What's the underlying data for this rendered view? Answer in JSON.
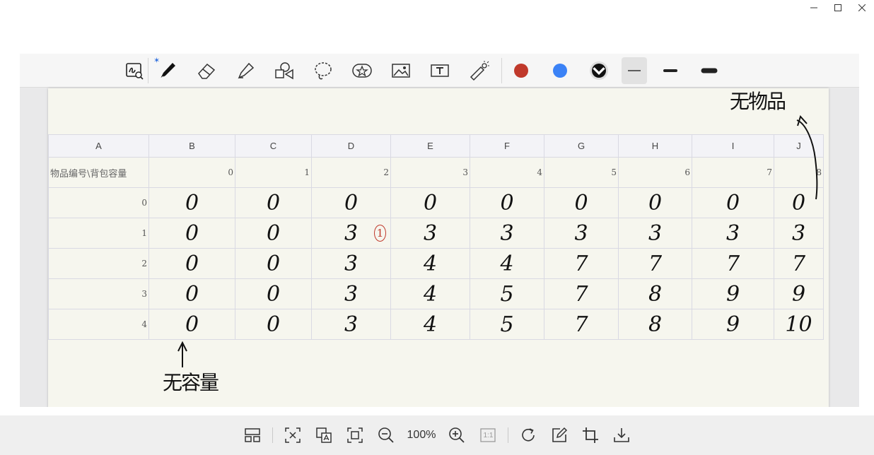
{
  "window": {
    "minimize": "minimize",
    "maximize": "maximize",
    "close": "close"
  },
  "toolbar": {
    "tools": [
      "screenshot-search-icon",
      "pen-icon",
      "eraser-icon",
      "highlighter-icon",
      "shapes-icon",
      "lasso-icon",
      "sticker-icon",
      "image-icon",
      "text-icon",
      "laser-pointer-icon"
    ],
    "bluetooth_badge": "✶",
    "colors": [
      "#c0392b",
      "#3b82f6",
      "#111111"
    ],
    "stroke_widths": [
      "thin",
      "medium",
      "thick"
    ]
  },
  "sheet": {
    "columns": [
      "A",
      "B",
      "C",
      "D",
      "E",
      "F",
      "G",
      "H",
      "I",
      "J"
    ],
    "row_label": "物品编号\\背包容量",
    "capacities": [
      "0",
      "1",
      "2",
      "3",
      "4",
      "5",
      "6",
      "7",
      "8"
    ],
    "rows": [
      {
        "id": "0",
        "values": [
          "0",
          "0",
          "0",
          "0",
          "0",
          "0",
          "0",
          "0",
          "0"
        ]
      },
      {
        "id": "1",
        "values": [
          "0",
          "0",
          "3",
          "3",
          "3",
          "3",
          "3",
          "3",
          "3"
        ]
      },
      {
        "id": "2",
        "values": [
          "0",
          "0",
          "3",
          "4",
          "4",
          "7",
          "7",
          "7",
          "7"
        ]
      },
      {
        "id": "3",
        "values": [
          "0",
          "0",
          "3",
          "4",
          "5",
          "7",
          "8",
          "9",
          "9"
        ]
      },
      {
        "id": "4",
        "values": [
          "0",
          "0",
          "3",
          "4",
          "5",
          "7",
          "8",
          "9",
          "10"
        ]
      }
    ],
    "red_mark": "1"
  },
  "annotations": {
    "top": "无物品",
    "bottom": "无容量"
  },
  "bottom_toolbar": {
    "zoom": "100%",
    "ratio": "1:1"
  }
}
